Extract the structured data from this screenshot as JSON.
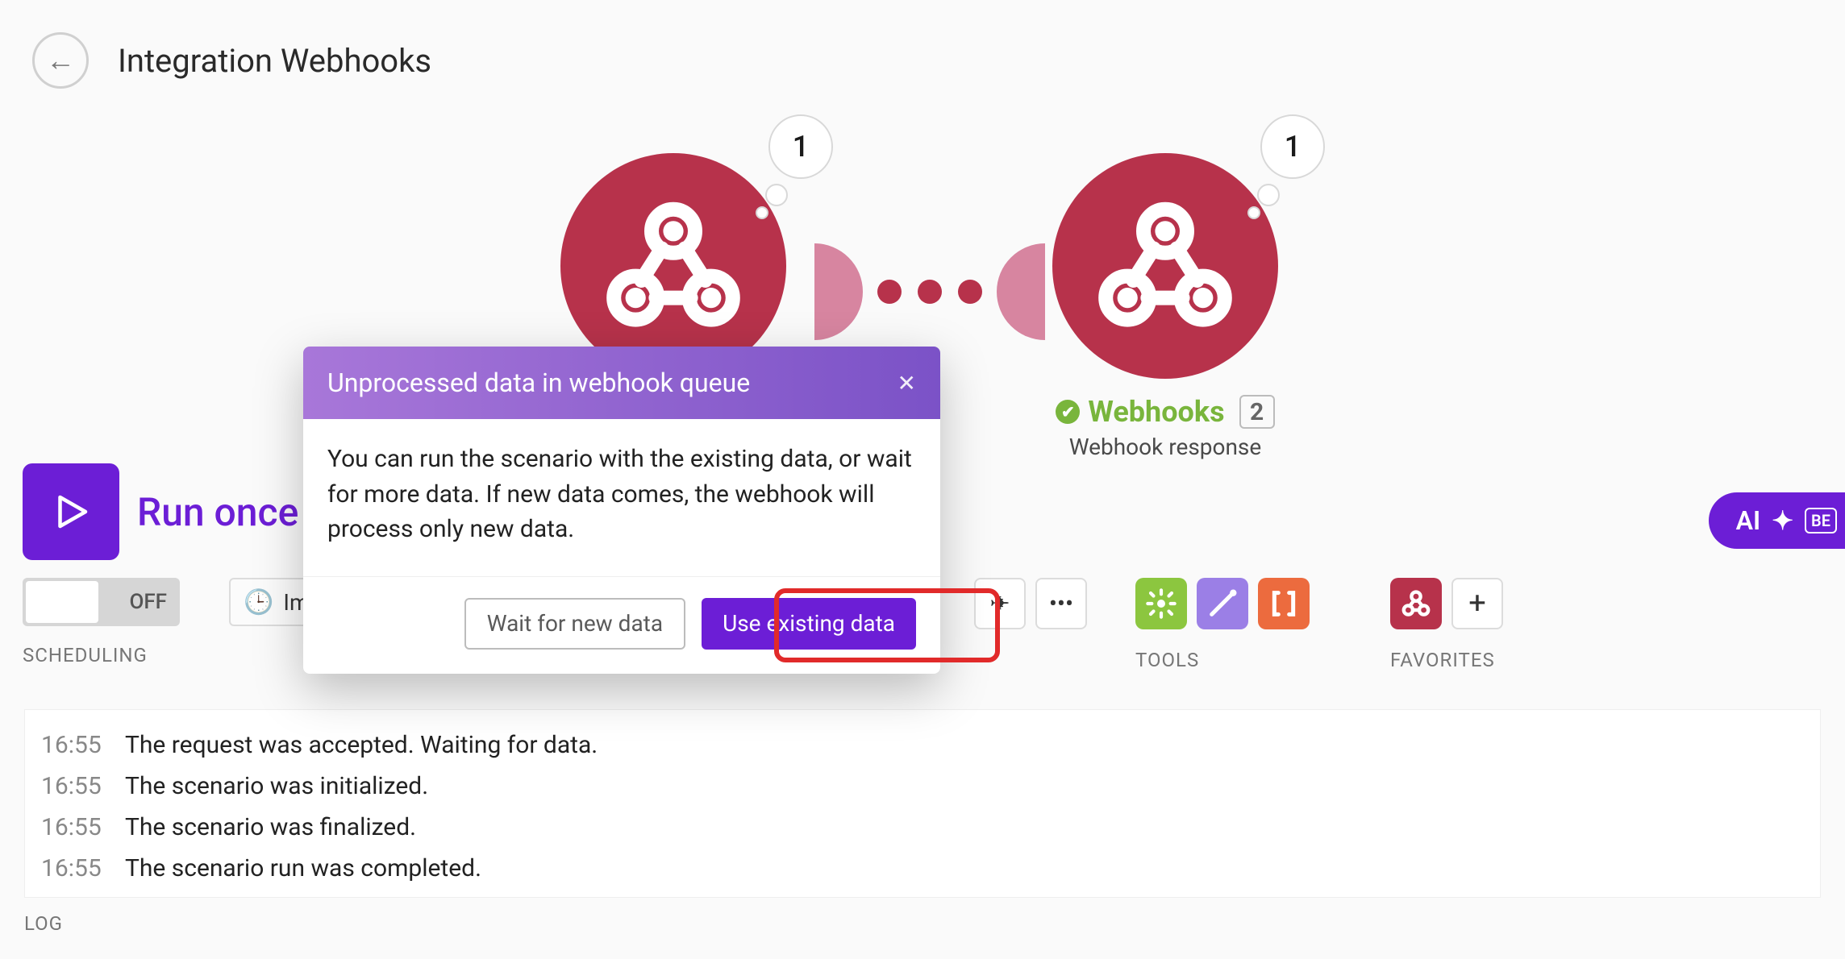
{
  "header": {
    "title": "Integration Webhooks"
  },
  "modules": {
    "module1": {
      "badge": "1"
    },
    "module2": {
      "badge": "1",
      "name": "Webhooks",
      "order": "2",
      "subtitle": "Webhook response"
    }
  },
  "controls": {
    "run_label": "Run once",
    "toggle_state": "OFF",
    "scheduling_label": "SCHEDULING",
    "clock_text": "Im",
    "tools_label": "TOOLS",
    "favorites_label": "FAVORITES",
    "ai_label": "AI",
    "ai_beta": "BE"
  },
  "dialog": {
    "title": "Unprocessed data in webhook queue",
    "body": "You can run the scenario with the existing data, or wait for more data. If new data comes, the webhook will process only new data.",
    "btn_wait": "Wait for new data",
    "btn_use": "Use existing data"
  },
  "log_label": "LOG",
  "log": [
    {
      "time": "16:55",
      "message": "The request was accepted. Waiting for data."
    },
    {
      "time": "16:55",
      "message": "The scenario was initialized."
    },
    {
      "time": "16:55",
      "message": "The scenario was finalized."
    },
    {
      "time": "16:55",
      "message": "The scenario run was completed."
    }
  ]
}
